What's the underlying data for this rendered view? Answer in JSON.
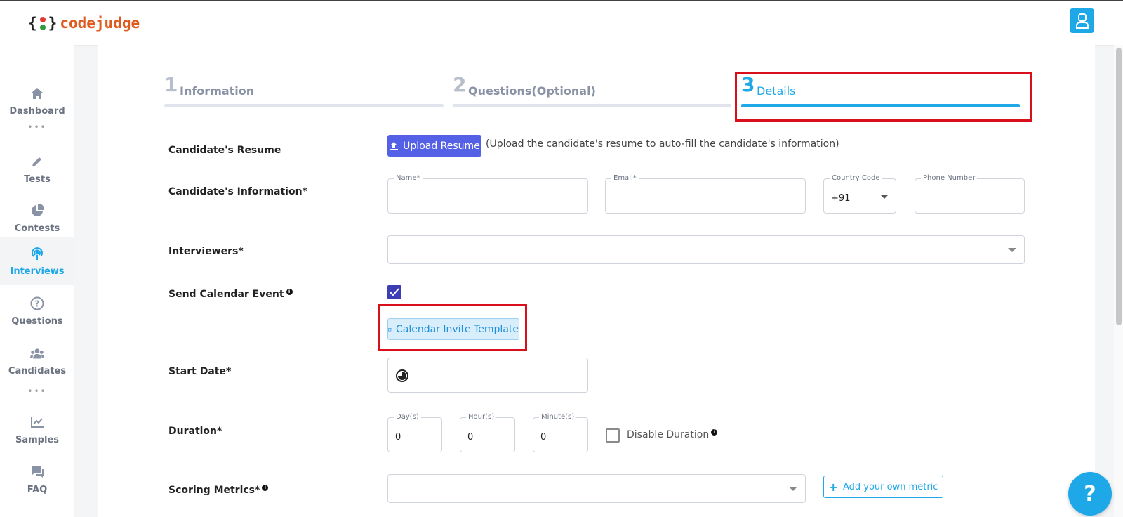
{
  "app": {
    "logo_left_brace": "{",
    "logo_right_brace": "}",
    "logo_name": "codejudge"
  },
  "header": {
    "profile_icon": "user-icon"
  },
  "sidebar": {
    "items": [
      {
        "label": "Dashboard",
        "icon": "home-icon"
      },
      {
        "label": "Tests",
        "icon": "pencil-icon"
      },
      {
        "label": "Contests",
        "icon": "pie-chart-icon"
      },
      {
        "label": "Interviews",
        "icon": "broadcast-icon"
      },
      {
        "label": "Questions",
        "icon": "question-circle-icon"
      },
      {
        "label": "Candidates",
        "icon": "users-icon"
      },
      {
        "label": "Samples",
        "icon": "line-chart-icon"
      },
      {
        "label": "FAQ",
        "icon": "chat-icon"
      }
    ],
    "separator": "•••",
    "active": "Interviews"
  },
  "steps": [
    {
      "number": "1",
      "label": "Information"
    },
    {
      "number": "2",
      "label": "Questions(Optional)"
    },
    {
      "number": "3",
      "label": "Details"
    }
  ],
  "form": {
    "resume": {
      "label": "Candidate's Resume",
      "button": "Upload Resume",
      "hint": "(Upload the candidate's resume to auto-fill the candidate's information)"
    },
    "info": {
      "label": "Candidate's Information*",
      "name_label": "Name*",
      "email_label": "Email*",
      "country_code_label": "Country Code",
      "country_code_value": "+91",
      "phone_label": "Phone Number"
    },
    "interviewers": {
      "label": "Interviewers*"
    },
    "calendar": {
      "label": "Send Calendar Event",
      "checked": true,
      "template_button": "Calendar Invite Template"
    },
    "start_date": {
      "label": "Start Date*"
    },
    "duration": {
      "label": "Duration*",
      "days_label": "Day(s)",
      "days_value": "0",
      "hours_label": "Hour(s)",
      "hours_value": "0",
      "minutes_label": "Minute(s)",
      "minutes_value": "0",
      "disable_label": "Disable Duration",
      "disable_checked": false
    },
    "scoring": {
      "label": "Scoring Metrics*",
      "add_button": "Add your own metric"
    }
  },
  "info_marker": "i",
  "help_button": "?",
  "colors": {
    "accent": "#1fa8e8",
    "upload_button": "#5460e6",
    "highlight": "#d9101c",
    "brand_orange": "#e05a1e"
  }
}
